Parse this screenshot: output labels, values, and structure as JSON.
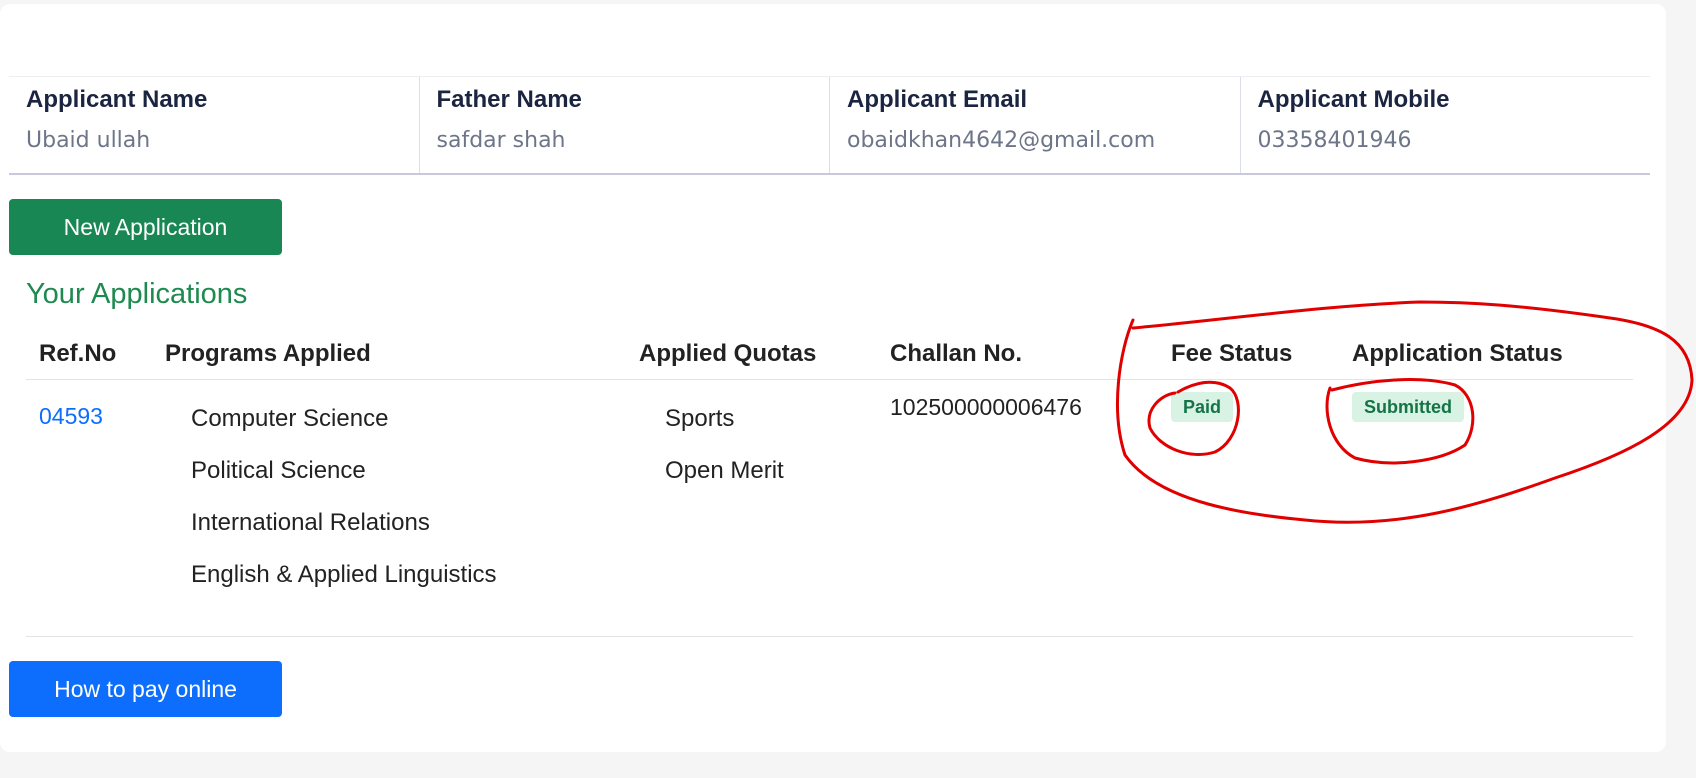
{
  "applicant": {
    "name_label": "Applicant Name",
    "name_value": "Ubaid ullah",
    "father_label": "Father Name",
    "father_value": "safdar shah",
    "email_label": "Applicant Email",
    "email_value": "obaidkhan4642@gmail.com",
    "mobile_label": "Applicant Mobile",
    "mobile_value": "03358401946"
  },
  "new_application_label": "New Application",
  "section_title": "Your Applications",
  "table": {
    "headers": {
      "ref": "Ref.No",
      "programs": "Programs Applied",
      "quotas": "Applied Quotas",
      "challan": "Challan No.",
      "fee_status": "Fee Status",
      "app_status": "Application Status"
    },
    "row": {
      "ref": "04593",
      "programs": [
        "Computer Science",
        "Political Science",
        "International Relations",
        "English & Applied Linguistics"
      ],
      "quotas": [
        "Sports",
        "Open Merit"
      ],
      "challan": "102500000006476",
      "fee_status": "Paid",
      "app_status": "Submitted"
    }
  },
  "how_to_pay_label": "How to pay online",
  "colors": {
    "primary_green": "#198754",
    "primary_blue": "#0d6efd",
    "badge_bg": "#d8f2e4",
    "annotation_red": "#e00000"
  }
}
